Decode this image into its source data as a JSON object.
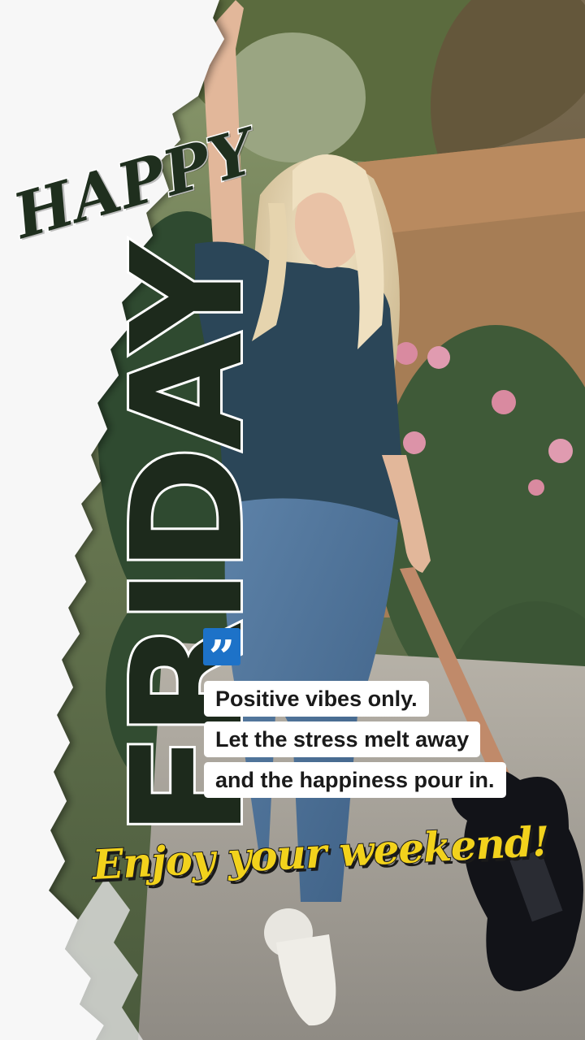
{
  "poster": {
    "title_top": "HAPPY",
    "title_main": "FRIDAY",
    "quote_lines": [
      "Positive vibes only.",
      "Let the stress melt away",
      "and the happiness pour in."
    ],
    "closing": "Enjoy your weekend!",
    "quote_icon": "”"
  },
  "colors": {
    "title_fill": "#1f2f1e",
    "title_outline": "#ffffff",
    "closing_fill": "#f2d21c",
    "quote_icon_bg": "#1d72c8",
    "quote_box_bg": "#ffffff"
  },
  "icons": [
    "quote-icon"
  ]
}
